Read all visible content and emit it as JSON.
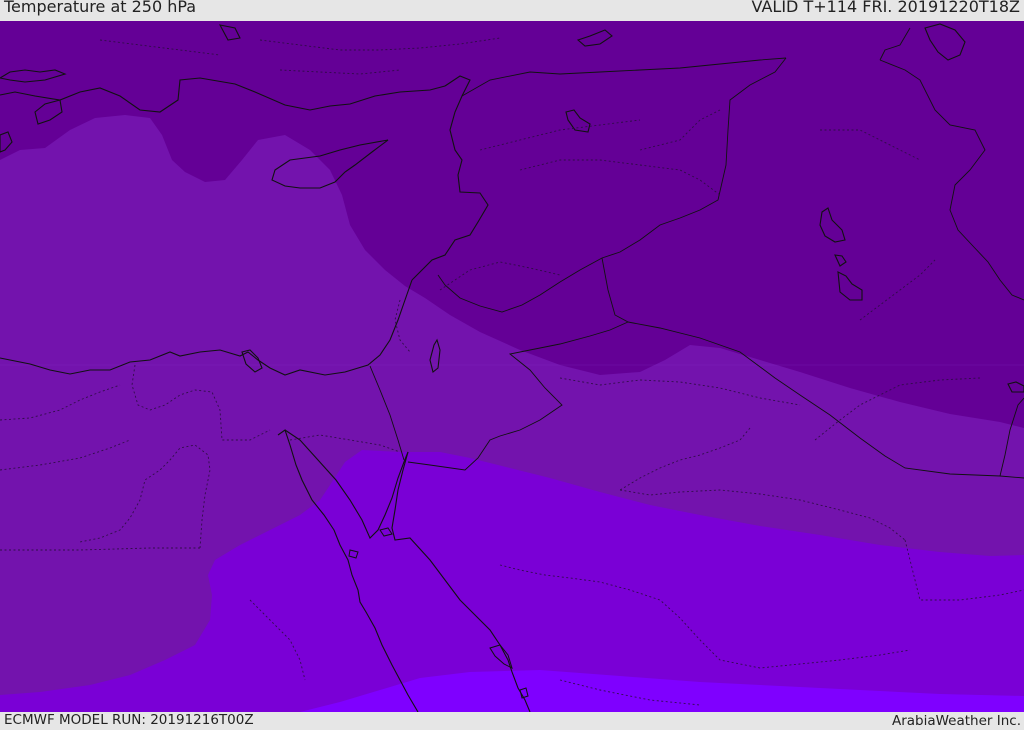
{
  "header": {
    "title": "Temperature at 250 hPa",
    "valid": "VALID T+114 FRI. 20191220T18Z"
  },
  "footer": {
    "model_run": "ECMWF MODEL RUN: 20191216T00Z",
    "brand": "ArabiaWeather Inc."
  },
  "map": {
    "colors": {
      "band_coldest": "#640096",
      "band_2": "#7313ad",
      "band_3": "#7a00d6",
      "band_warmest": "#7f00ff",
      "coastline": "#111111",
      "border": "#2b1040"
    }
  }
}
